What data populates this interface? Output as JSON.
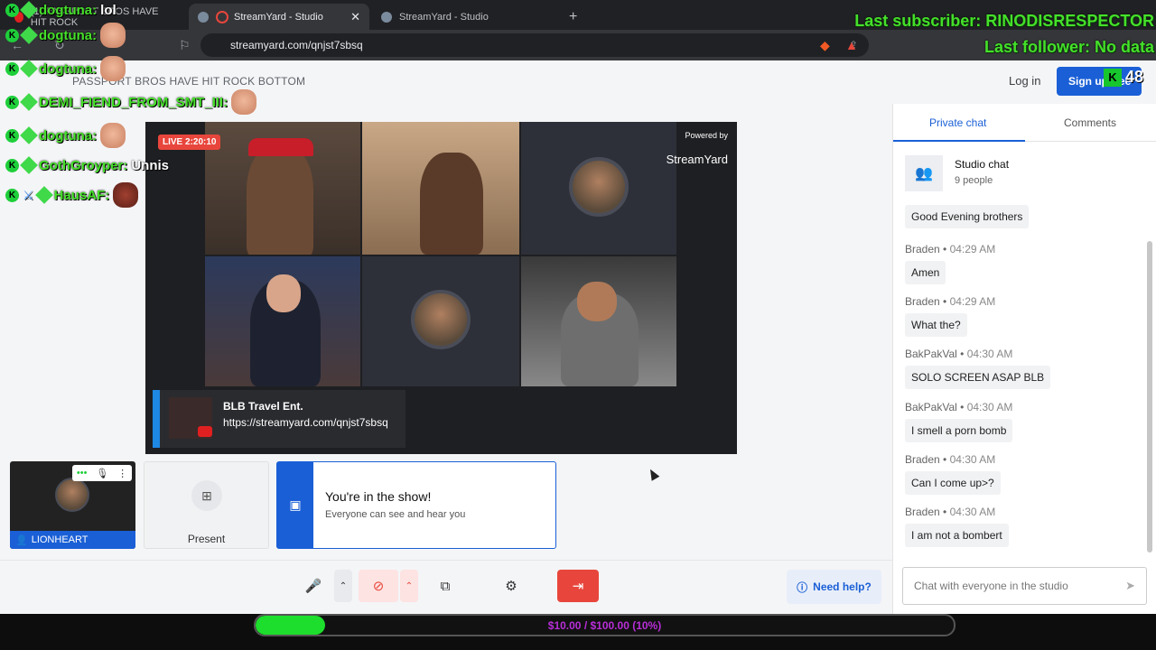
{
  "browser": {
    "tabs": [
      {
        "label": "(1) PASSPORT BROS HAVE HIT ROCK"
      },
      {
        "label": "StreamYard - Studio"
      },
      {
        "label": "StreamYard - Studio"
      }
    ],
    "url": "streamyard.com/qnjst7sbsq"
  },
  "header": {
    "broadcast_title": "PASSPORT BROS HAVE HIT ROCK BOTTOM",
    "login_label": "Log in",
    "signup_label": "Sign up free"
  },
  "stage": {
    "live_badge": "LIVE 2:20:10",
    "powered_by": "Powered by",
    "brand": "StreamYard",
    "banner_title": "BLB Travel Ent.",
    "banner_url": "https://streamyard.com/qnjst7sbsq"
  },
  "self_tile": {
    "name": "LIONHEART"
  },
  "present_tile": {
    "label": "Present"
  },
  "show_card": {
    "title": "You're in the show!",
    "subtitle": "Everyone can see and hear you"
  },
  "controls": {
    "need_help": "Need help?"
  },
  "chat": {
    "tab_private": "Private chat",
    "tab_comments": "Comments",
    "room_name": "Studio chat",
    "room_count": "9 people",
    "messages": [
      {
        "author": "",
        "time": "",
        "text": "Good Evening brothers"
      },
      {
        "author": "Braden",
        "time": "04:29 AM",
        "text": "Amen"
      },
      {
        "author": "Braden",
        "time": "04:29 AM",
        "text": "What the?"
      },
      {
        "author": "BakPakVal",
        "time": "04:30 AM",
        "text": "SOLO SCREEN ASAP BLB"
      },
      {
        "author": "BakPakVal",
        "time": "04:30 AM",
        "text": "I smell a porn bomb"
      },
      {
        "author": "Braden",
        "time": "04:30 AM",
        "text": "Can I come up>?"
      },
      {
        "author": "Braden",
        "time": "04:30 AM",
        "text": "I am not a bombert"
      }
    ],
    "input_placeholder": "Chat with everyone in the studio"
  },
  "overlay": {
    "chat_lines": [
      {
        "user": "dogtuna:",
        "text": "lol"
      },
      {
        "user": "dogtuna:",
        "text": ""
      },
      {
        "user": "dogtuna:",
        "text": ""
      },
      {
        "user": "DEMI_FIEND_FROM_SMT_III:",
        "text": ""
      },
      {
        "user": "dogtuna:",
        "text": ""
      },
      {
        "user": "GothGroyper:",
        "text": "Unnis"
      },
      {
        "user": "HausAF:",
        "text": ""
      }
    ],
    "last_subscriber": "Last subscriber: RINODISRESPECTOR",
    "last_follower": "Last follower: No data",
    "k_counter": "48",
    "goal_text": "$10.00 / $100.00 (10%)",
    "goal_fraction": 0.1
  },
  "colors": {
    "accent": "#1a5fd6",
    "live": "#e8463c",
    "overlay_green": "#45e02a"
  }
}
